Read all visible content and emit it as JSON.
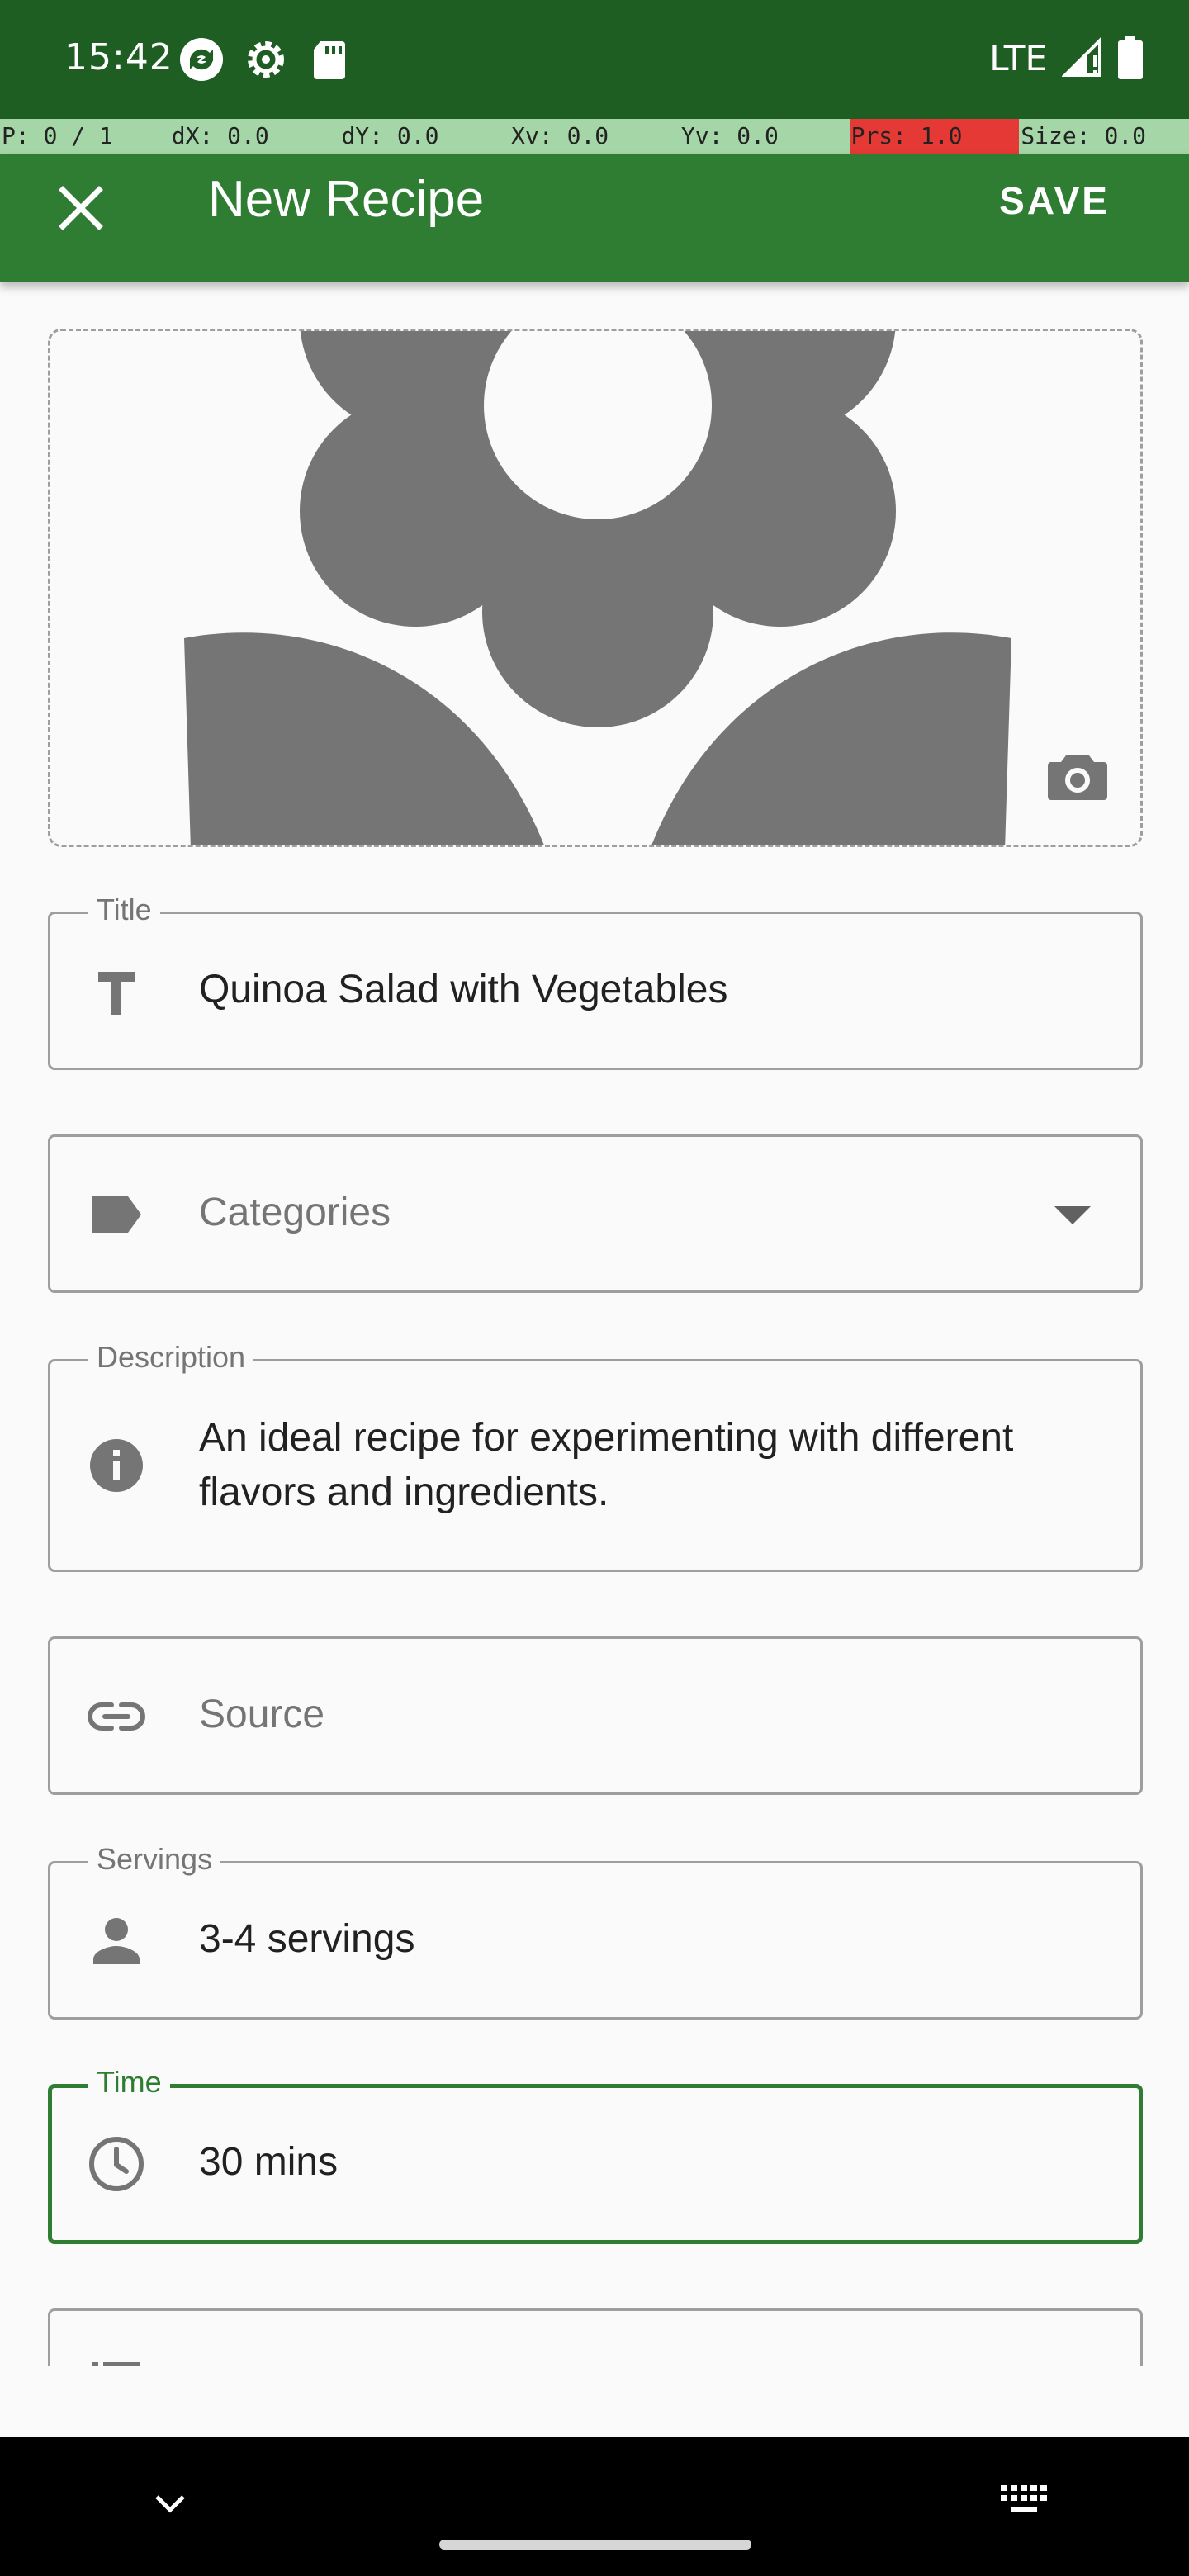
{
  "status_bar": {
    "time": "15:42",
    "network": "LTE",
    "left_icons": [
      "sync-icon",
      "settings-gear-icon",
      "sd-card-icon"
    ],
    "right_icons": [
      "signal-icon",
      "battery-icon"
    ]
  },
  "debug_strip": [
    "P: 0 / 1",
    "dX: 0.0",
    "dY: 0.0",
    "Xv: 0.0",
    "Yv: 0.0",
    "Prs: 1.0",
    "Size: 0.0"
  ],
  "app_bar": {
    "title": "New Recipe",
    "save_label": "SAVE",
    "background": "#2e7d32"
  },
  "image_picker": {
    "placeholder_icon": "flower-image-placeholder-icon",
    "camera_icon": "camera-icon"
  },
  "form": {
    "title": {
      "label": "Title",
      "value": "Quinoa Salad with Vegetables",
      "icon": "text-title-icon"
    },
    "categories": {
      "placeholder": "Categories",
      "icon": "label-tag-icon"
    },
    "description": {
      "label": "Description",
      "value": "An ideal recipe for experimenting with different flavors and ingredients.",
      "icon": "info-icon"
    },
    "source": {
      "placeholder": "Source",
      "icon": "link-icon"
    },
    "servings": {
      "label": "Servings",
      "value": "3-4 servings",
      "icon": "person-icon"
    },
    "time": {
      "label": "Time",
      "value": "30 mins",
      "icon": "clock-icon",
      "focused": true
    }
  },
  "colors": {
    "accent": "#2e7d32",
    "status_bar": "#1e5e23",
    "debug_bg": "#a5d6a7",
    "debug_alert": "#e53935"
  }
}
